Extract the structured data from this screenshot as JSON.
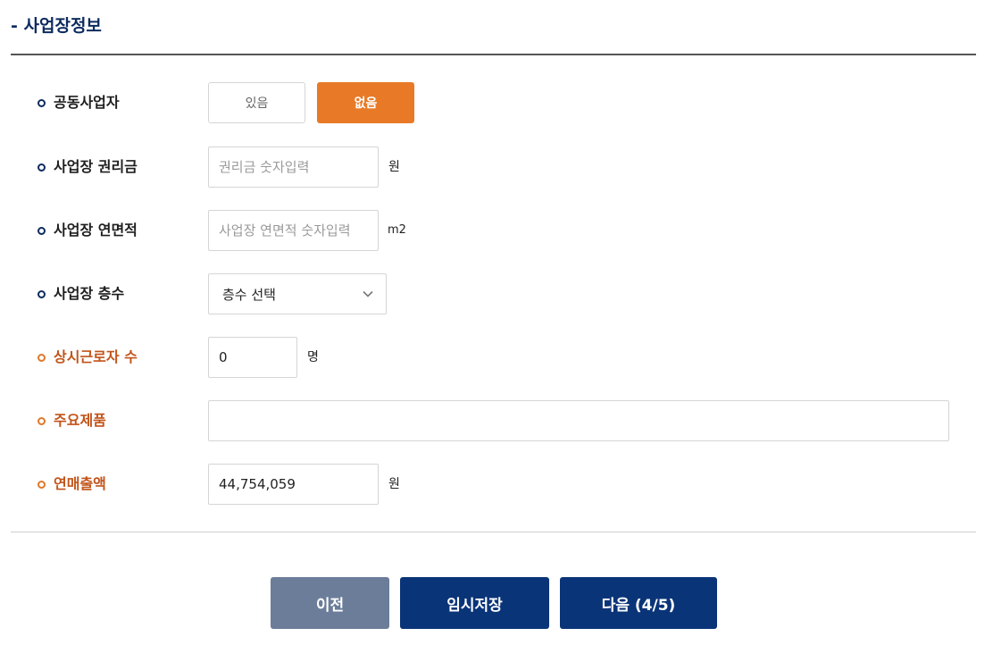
{
  "section": {
    "title": "- 사업장정보"
  },
  "rows": {
    "co_business": {
      "label": "공동사업자",
      "options": [
        "있음",
        "없음"
      ],
      "selected": "없음"
    },
    "premium": {
      "label": "사업장 권리금",
      "placeholder": "권리금 숫자입력",
      "unit": "원"
    },
    "area": {
      "label": "사업장 연면적",
      "placeholder": "사업장 연면적 숫자입력",
      "unit": "m2"
    },
    "floors": {
      "label": "사업장 층수",
      "selected": "층수 선택",
      "icon": "chevron-down-icon"
    },
    "employees": {
      "label": "상시근로자 수",
      "value": "0",
      "unit": "명"
    },
    "products": {
      "label": "주요제품",
      "value": ""
    },
    "sales": {
      "label": "연매출액",
      "value": "44,754,059",
      "unit": "원"
    }
  },
  "buttons": {
    "prev": "이전",
    "temp_save": "임시저장",
    "next": "다음 (4/5)"
  },
  "colors": {
    "navy": "#0a3478",
    "orange": "#e87a27",
    "prev_button": "#6b7d99",
    "required_label": "#c2541a"
  }
}
